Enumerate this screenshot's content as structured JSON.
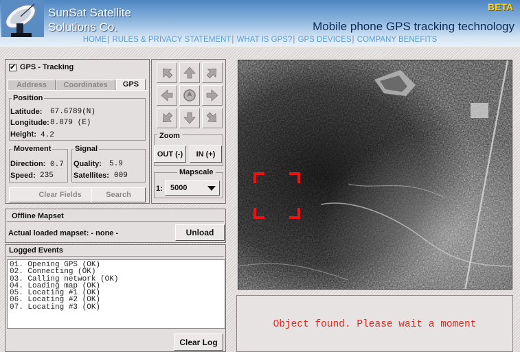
{
  "header": {
    "company_line1": "SunSat Satellite",
    "company_line2": "Solutions Co.",
    "beta": "BETA",
    "tagline": "Mobile phone GPS tracking technology"
  },
  "nav": [
    "HOME",
    "RULES & PRIVACY STATEMENT",
    "WHAT IS GPS?",
    "GPS DEVICES",
    "COMPANY BENEFITS"
  ],
  "tracking": {
    "checkbox_label": "GPS - Tracking",
    "checked": true,
    "tabs": [
      "Address",
      "Coordinates",
      "GPS"
    ],
    "active_tab": "GPS",
    "position_title": "Position",
    "latitude_label": "Latitude:",
    "latitude_value": "67.6789(N)",
    "longitude_label": "Longitude:",
    "longitude_value": "8.879 (E)",
    "height_label": "Height:",
    "height_value": "4.2",
    "movement_title": "Movement",
    "direction_label": "Direction:",
    "direction_value": "0.7",
    "speed_label": "Speed:",
    "speed_value": "235",
    "signal_title": "Signal",
    "quality_label": "Quality:",
    "quality_value": "5.9",
    "satellites_label": "Satellites:",
    "satellites_value": "009",
    "clear_fields": "Clear Fields",
    "search": "Search"
  },
  "controls": {
    "zoom_title": "Zoom",
    "zoom_out": "OUT (-)",
    "zoom_in": "IN (+)",
    "mapscale_title": "Mapscale",
    "mapscale_prefix": "1:",
    "mapscale_value": "5000"
  },
  "mapset": {
    "title": "Offline Mapset",
    "loaded_text": "Actual loaded mapset: - none -",
    "unload": "Unload"
  },
  "events": {
    "title": "Logged Events",
    "lines": [
      "01. Opening GPS (OK)",
      "02. Connecting (OK)",
      "03. Calling network (OK)",
      "04. Loading map (OK)",
      "05. Locating #1 (OK)",
      "06. Locating #2 (OK)",
      "07. Locating #3 (OK)"
    ],
    "clear_log": "Clear Log"
  },
  "status": {
    "message": "Object found. Please wait a moment",
    "color": "#e4261c"
  },
  "icons": {
    "logo": "satellite-dish-icon",
    "pad": [
      "arrow-up-left-icon",
      "arrow-up-icon",
      "arrow-up-right-icon",
      "arrow-left-icon",
      "target-center-icon",
      "arrow-right-icon",
      "arrow-down-left-icon",
      "arrow-down-icon",
      "arrow-down-right-icon"
    ]
  }
}
